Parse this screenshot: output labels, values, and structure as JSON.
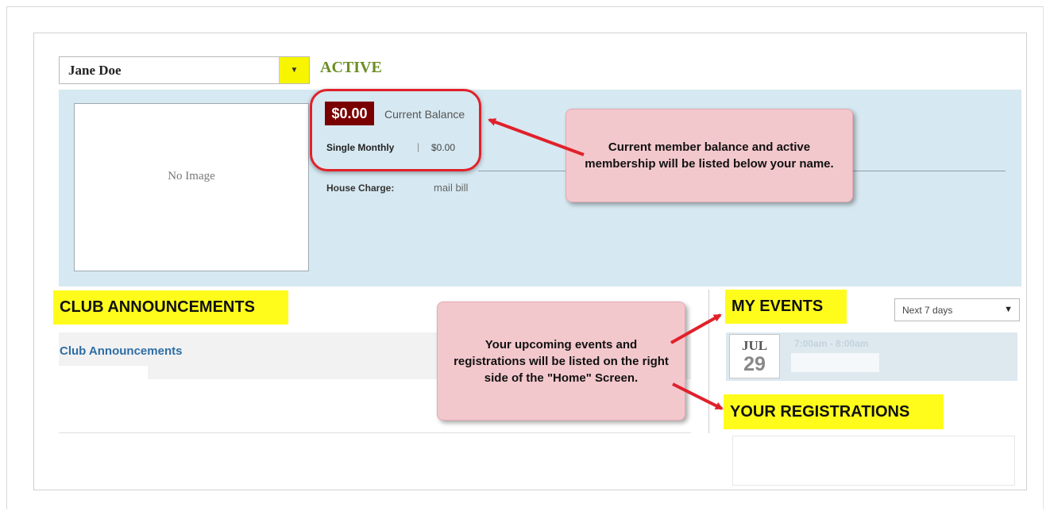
{
  "member": {
    "selected_name": "Jane Doe",
    "status": "ACTIVE"
  },
  "profile": {
    "photo_placeholder": "No Image",
    "balance": "$0.00",
    "balance_label": "Current Balance",
    "membership_name": "Single Monthly",
    "membership_separator": "|",
    "membership_amount": "$0.00",
    "house_charge_label": "House Charge:",
    "house_charge_value": "mail bill"
  },
  "callouts": {
    "balance_note": "Current member balance and active membership will be listed below your name.",
    "events_note": "Your upcoming events and registrations will be listed on the right side of the \"Home\" Screen."
  },
  "announcements": {
    "heading": "CLUB ANNOUNCEMENTS",
    "items": [
      {
        "label": "Club Announcements"
      }
    ]
  },
  "events": {
    "heading": "MY EVENTS",
    "range_selected": "Next 7 days",
    "items": [
      {
        "month": "JUL",
        "day": "29",
        "time": "7:00am - 8:00am"
      }
    ]
  },
  "registrations": {
    "heading": "YOUR REGISTRATIONS"
  },
  "colors": {
    "active_status": "#6b8e23",
    "highlight_yellow": "#fffc1c",
    "callout_pink": "#f3c8cd",
    "annotation_red": "#e0212a",
    "balance_badge": "#7a0000",
    "profile_band": "#d6e8f1",
    "link_blue": "#2e6ea6"
  },
  "icons": {
    "member_dropdown": "chevron-down-icon",
    "range_dropdown": "chevron-down-icon",
    "annotation": "red-arrow-icon"
  }
}
